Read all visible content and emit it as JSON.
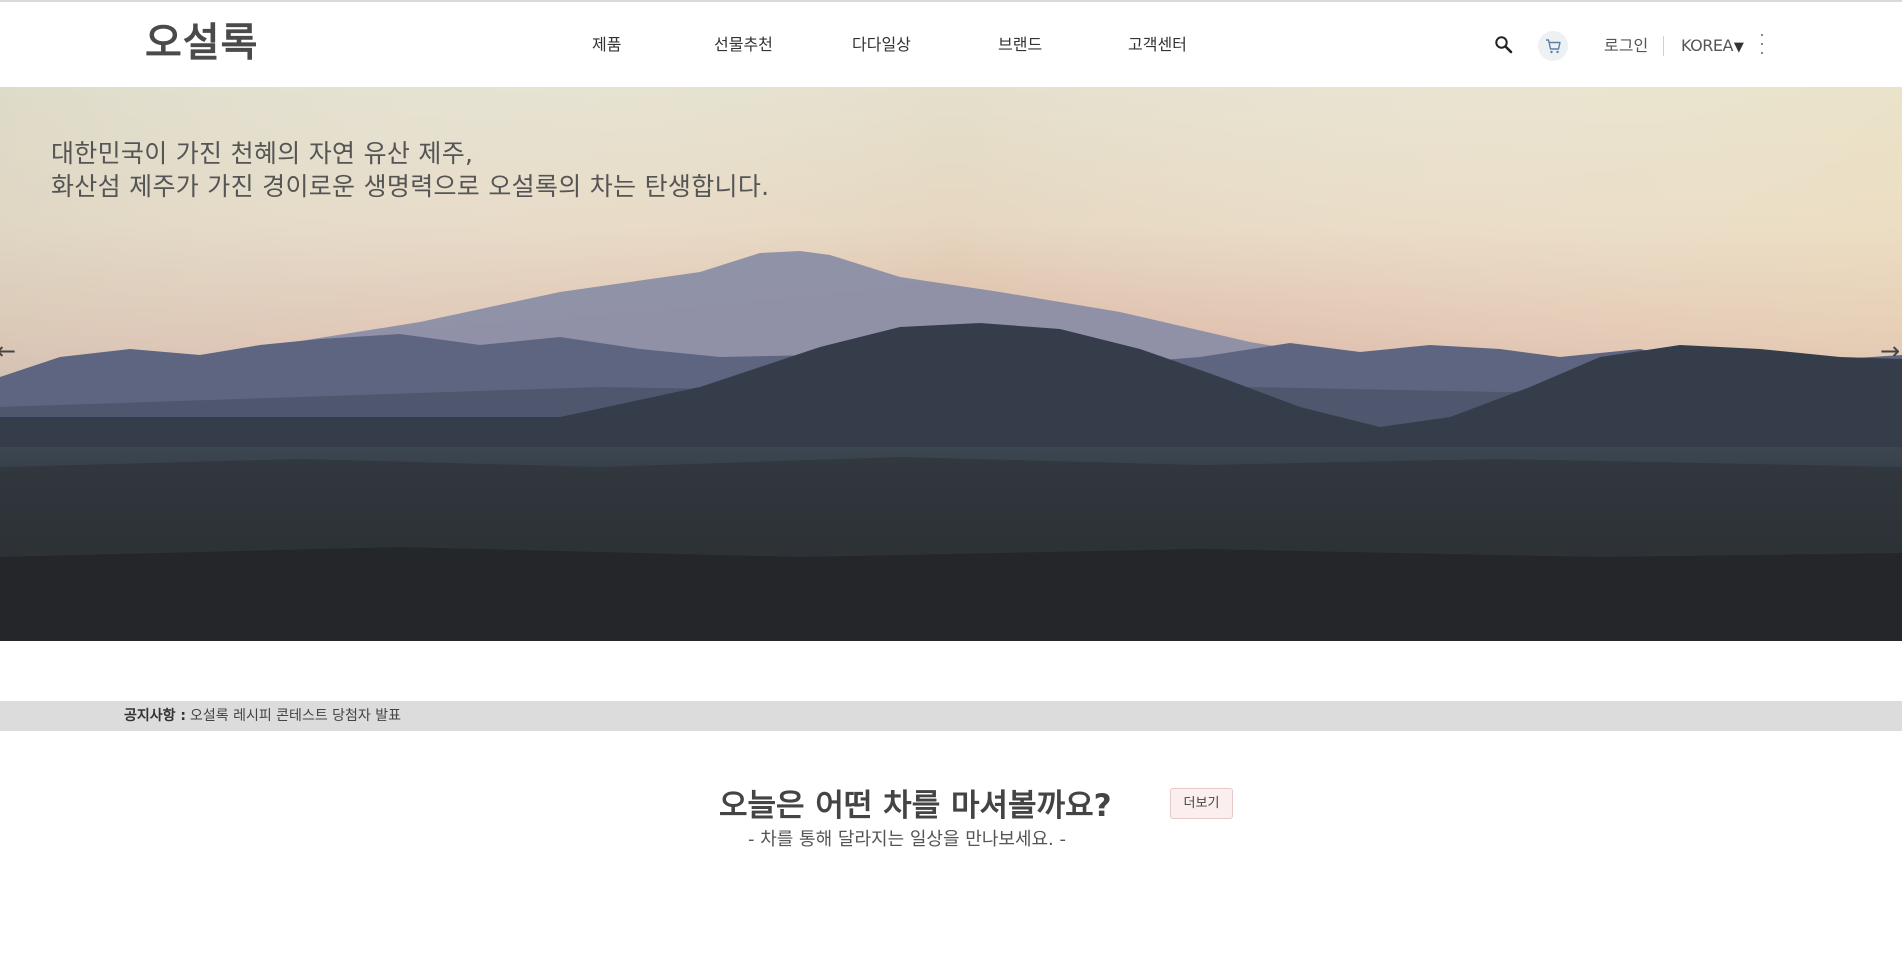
{
  "header": {
    "logo": "오설록",
    "nav": [
      "제품",
      "선물추천",
      "다다일상",
      "브랜드",
      "고객센터"
    ],
    "login": "로그인",
    "language": "KOREA",
    "language_caret": "▼"
  },
  "hero": {
    "line1": "대한민국이 가진 천혜의 자연 유산 제주,",
    "line2": "화산섬 제주가 가진 경이로운 생명력으로 오설록의 차는 탄생합니다.",
    "prev_arrow": "←",
    "next_arrow": "→"
  },
  "notice": {
    "label": "공지사항 :",
    "text": "오설록 레시피 콘테스트 당첨자 발표"
  },
  "section": {
    "title": "오늘은 어떤 차를 마셔볼까요?",
    "subtitle": "- 차를 통해 달라지는 일상을 만나보세요. -",
    "more": "더보기"
  },
  "icons": {
    "search": "search-icon",
    "cart": "cart-icon",
    "more": "more-vertical-icon"
  },
  "colors": {
    "notice_bg": "#dcdcdc",
    "more_button_bg": "#fbeeee",
    "more_button_border": "#e8c9c9"
  }
}
